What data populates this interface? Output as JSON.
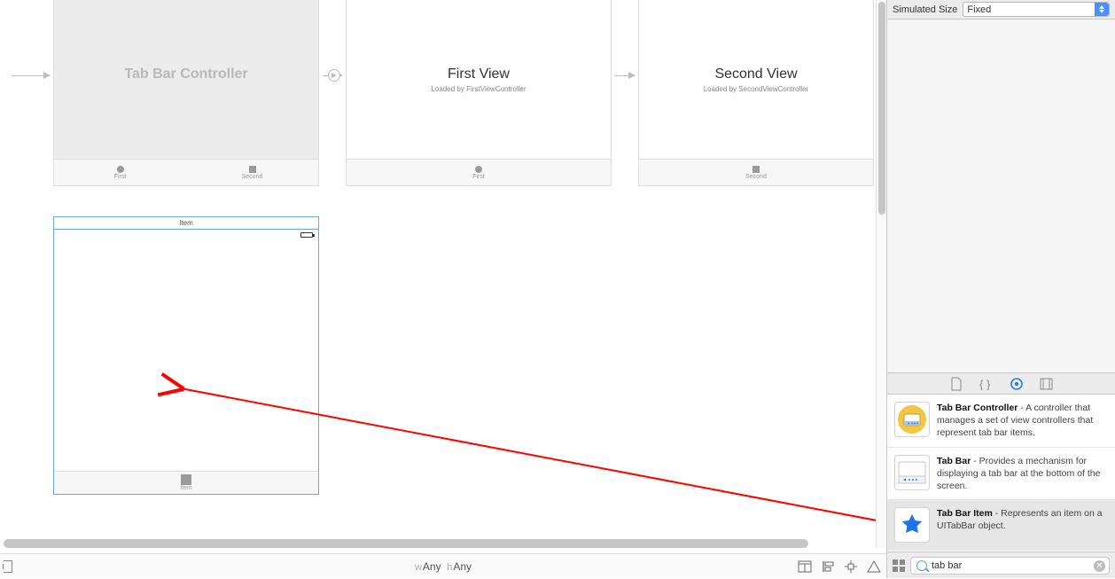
{
  "canvas": {
    "scene1": {
      "title": "Tab Bar Controller",
      "tabs": [
        "First",
        "Second"
      ]
    },
    "scene2": {
      "title": "First View",
      "subtitle": "Loaded by FirstViewController",
      "tab": "First"
    },
    "scene3": {
      "title": "Second View",
      "subtitle": "Loaded by SecondViewController",
      "tab": "Second"
    },
    "scene4": {
      "titlebar": "Item",
      "tab_label": "Item"
    }
  },
  "bottom": {
    "w_prefix": "w",
    "w": "Any",
    "h_prefix": "h",
    "h": "Any"
  },
  "inspector": {
    "simulated_size_label": "Simulated Size",
    "simulated_size_value": "Fixed"
  },
  "library": {
    "items": [
      {
        "name": "Tab Bar Controller",
        "desc": " - A controller that manages a set of view controllers that represent tab bar items."
      },
      {
        "name": "Tab Bar",
        "desc": " - Provides a mechanism for displaying a tab bar at the bottom of the screen."
      },
      {
        "name": "Tab Bar Item",
        "desc": " - Represents an item on a UITabBar object."
      }
    ],
    "search_value": "tab bar"
  }
}
